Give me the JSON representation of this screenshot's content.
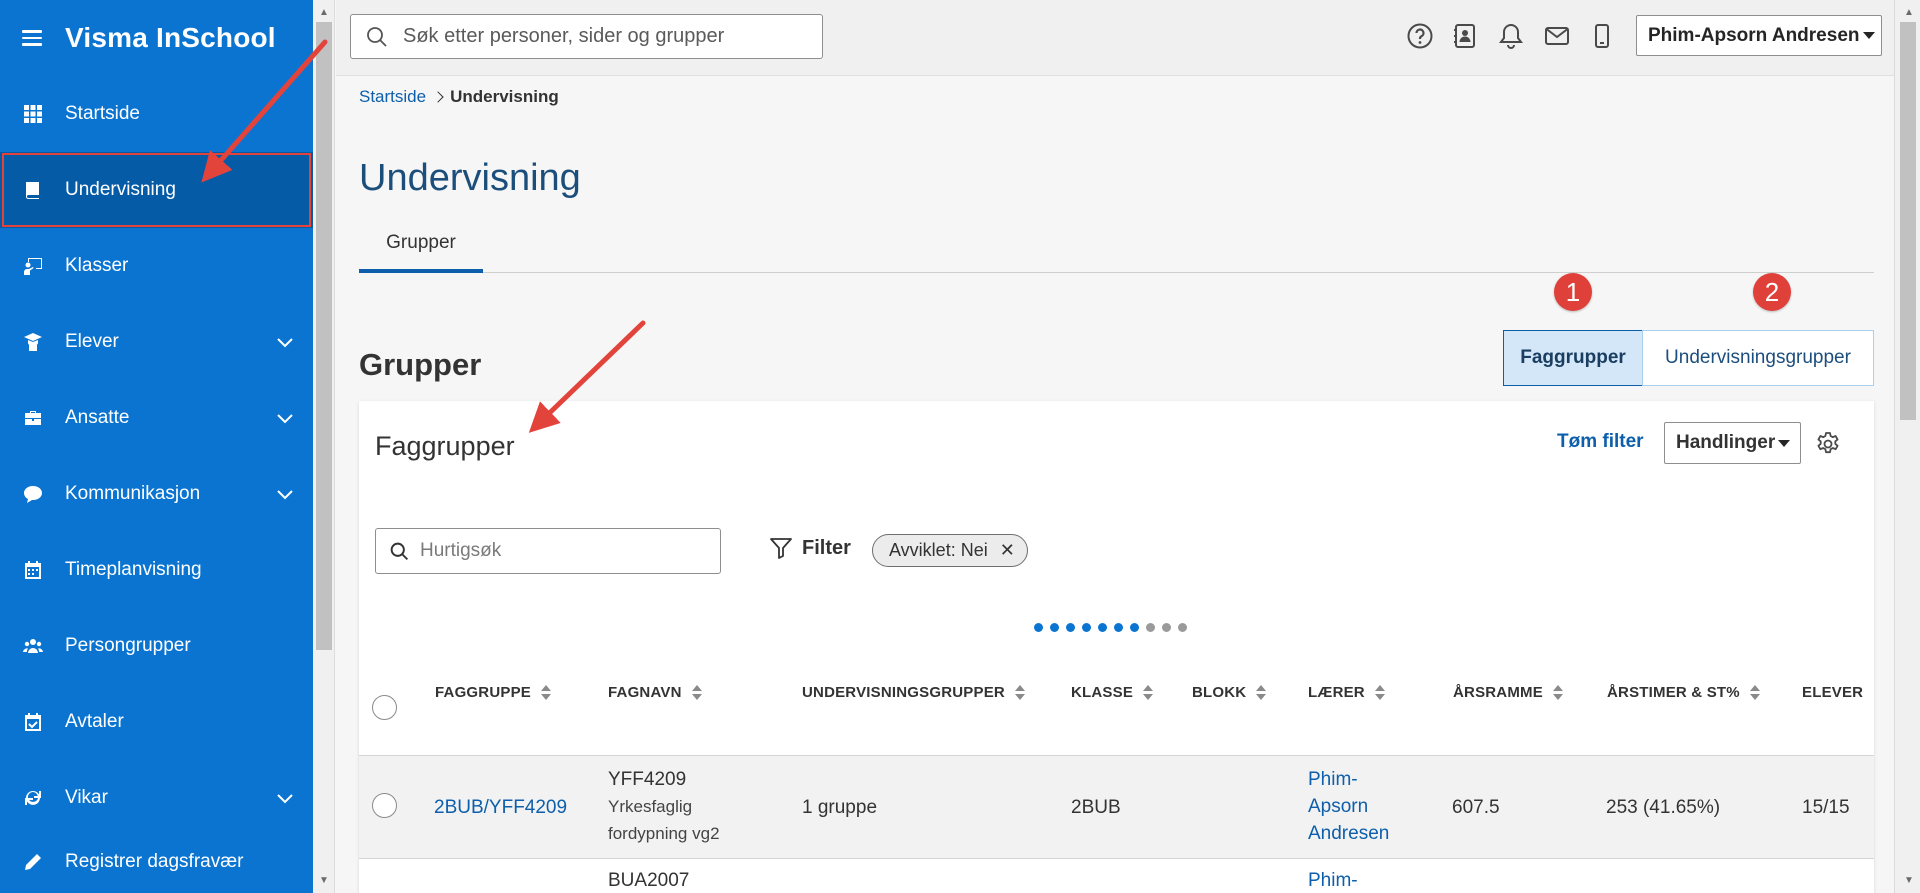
{
  "app": {
    "title": "Visma InSchool"
  },
  "sidebar": {
    "items": [
      {
        "label": "Startside",
        "icon": "grid-icon",
        "expandable": false
      },
      {
        "label": "Undervisning",
        "icon": "book-icon",
        "expandable": false,
        "active": true
      },
      {
        "label": "Klasser",
        "icon": "classroom-icon",
        "expandable": false
      },
      {
        "label": "Elever",
        "icon": "graduation-cap-icon",
        "expandable": true
      },
      {
        "label": "Ansatte",
        "icon": "briefcase-icon",
        "expandable": true
      },
      {
        "label": "Kommunikasjon",
        "icon": "chat-bubble-icon",
        "expandable": true
      },
      {
        "label": "Timeplanvisning",
        "icon": "calendar-icon",
        "expandable": false
      },
      {
        "label": "Persongrupper",
        "icon": "users-icon",
        "expandable": false
      },
      {
        "label": "Avtaler",
        "icon": "calendar-check-icon",
        "expandable": false
      },
      {
        "label": "Vikar",
        "icon": "refresh-icon",
        "expandable": true
      },
      {
        "label": "Registrer dagsfravær",
        "icon": "pencil-icon",
        "expandable": false
      }
    ]
  },
  "topbar": {
    "search_placeholder": "Søk etter personer, sider og grupper",
    "icons": [
      "help-icon",
      "contact-book-icon",
      "bell-icon",
      "mail-icon",
      "mobile-icon"
    ],
    "user": "Phim-Apsorn Andresen"
  },
  "breadcrumb": {
    "home": "Startside",
    "current": "Undervisning"
  },
  "page": {
    "title": "Undervisning",
    "tab": "Grupper",
    "section_title": "Grupper"
  },
  "segments": {
    "first": "Faggrupper",
    "second": "Undervisningsgrupper",
    "badge1": "1",
    "badge2": "2"
  },
  "card": {
    "title": "Faggrupper",
    "clear_filter": "Tøm filter",
    "actions": "Handlinger",
    "quick_search_placeholder": "Hurtigsøk",
    "filter_label": "Filter",
    "chip": "Avviklet: Nei",
    "chip_close": "✕"
  },
  "table": {
    "columns": [
      "FAGGRUPPE",
      "FAGNAVN",
      "UNDERVISNINGSGRUPPER",
      "KLASSE",
      "BLOKK",
      "LÆRER",
      "ÅRSRAMME",
      "ÅRSTIMER & ST%",
      "ELEVER"
    ],
    "rows": [
      {
        "faggruppe": "2BUB/YFF4209",
        "fagnavn_code": "YFF4209",
        "fagnavn_line2": "Yrkesfaglig",
        "fagnavn_line3": "fordypning vg2",
        "undervisningsgrupper": "1 gruppe",
        "klasse": "2BUB",
        "blokk": "",
        "laerer_line1": "Phim-",
        "laerer_line2": "Apsorn",
        "laerer_line3": "Andresen",
        "arsramme": "607.5",
        "arstimer": "253 (41.65%)",
        "elever": "15/15"
      },
      {
        "fagnavn_code": "BUA2007",
        "laerer_line1": "Phim-"
      }
    ]
  },
  "colors": {
    "sidebar": "#0a74d0",
    "sidebar_active": "#065ba6",
    "link": "#0d5fab",
    "annotation": "#e0403a"
  }
}
